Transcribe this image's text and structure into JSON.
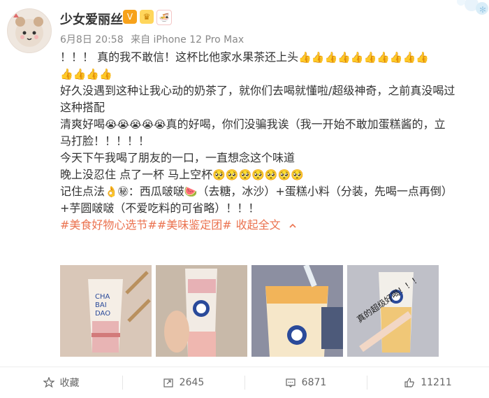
{
  "user": {
    "name": "少女爱丽丝",
    "avatar": "avatar-illustration"
  },
  "post": {
    "date": "6月8日 20:58",
    "source": "来自 iPhone 12 Pro Max",
    "lines": [
      "！！！ 真的我不敢信！这杯比他家水果茶还上头",
      "",
      "好久没遇到这种让我心动的奶茶了，就你们去喝就懂啦/超级神奇，之前真没喝过",
      "这种搭配",
      "清爽好喝",
      "真的好喝，你们没骗我诶（我一开始不敢加蛋糕酱的，立",
      "马打脸！！！！！",
      "今天下午我喝了朋友的一口，一直想念这个味道",
      "晚上没忍住 点了一杯 马上空杯",
      "记住点法",
      "：西瓜啵啵",
      "（去糖，冰沙）+蛋糕小料（分装，先喝一点再倒）",
      "+芋圆啵啵（不爱吃料的可省略）！！！"
    ],
    "hashtags": "#美食好物心选节##美味鉴定团#",
    "collapse": "收起全文",
    "collapse_icon": "chevron-up-icon",
    "photo_text": "真的超级好喝！！！"
  },
  "actions": {
    "favorite": "收藏",
    "repost": "2645",
    "comment": "6871",
    "like": "11211"
  },
  "colors": {
    "accent": "#eb7350",
    "photo1": "#d9c7b8",
    "photo2": "#c8b9a9",
    "photo3": "#8c8fa1",
    "photo4": "#bfc0c8"
  }
}
